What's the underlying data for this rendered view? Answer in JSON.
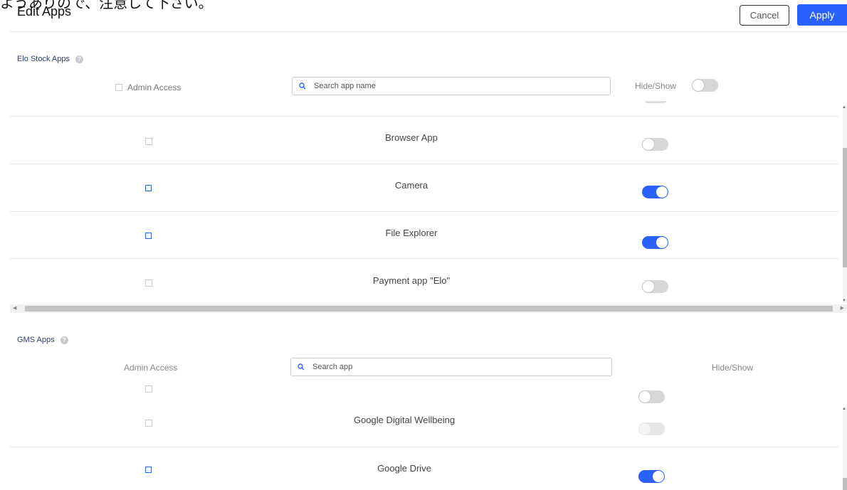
{
  "header": {
    "top_note": "ようありので、注意して下さい。",
    "title": "Edit Apps",
    "cancel_label": "Cancel",
    "apply_label": "Apply"
  },
  "stock_section": {
    "title": "Elo Stock Apps",
    "admin_access_label": "Admin Access",
    "search_placeholder": "Search app name",
    "hide_show_label": "Hide/Show",
    "master_toggle_on": false,
    "apps": [
      {
        "name": "Browser App",
        "admin": false,
        "admin_enabled": false,
        "visible": false
      },
      {
        "name": "Camera",
        "admin": false,
        "admin_enabled": true,
        "visible": true
      },
      {
        "name": "File Explorer",
        "admin": false,
        "admin_enabled": true,
        "visible": true
      },
      {
        "name": "Payment app \"Elo\"",
        "admin": false,
        "admin_enabled": false,
        "visible": false
      }
    ]
  },
  "gms_section": {
    "title": "GMS Apps",
    "admin_access_label": "Admin Access",
    "search_placeholder": "Search app",
    "hide_show_label": "Hide/Show",
    "apps": [
      {
        "name": "",
        "admin": false,
        "admin_enabled": false,
        "visible": false
      },
      {
        "name": "Google Digital Wellbeing",
        "admin": false,
        "admin_enabled": false,
        "visible": false,
        "disabled": true
      },
      {
        "name": "Google Drive",
        "admin": false,
        "admin_enabled": true,
        "visible": true
      }
    ]
  },
  "colors": {
    "accent": "#2962ff",
    "toggle_off": "#d7d7d7",
    "section_title": "#2c3e6b"
  },
  "icons": {
    "search": "search-icon",
    "help": "help-icon"
  }
}
